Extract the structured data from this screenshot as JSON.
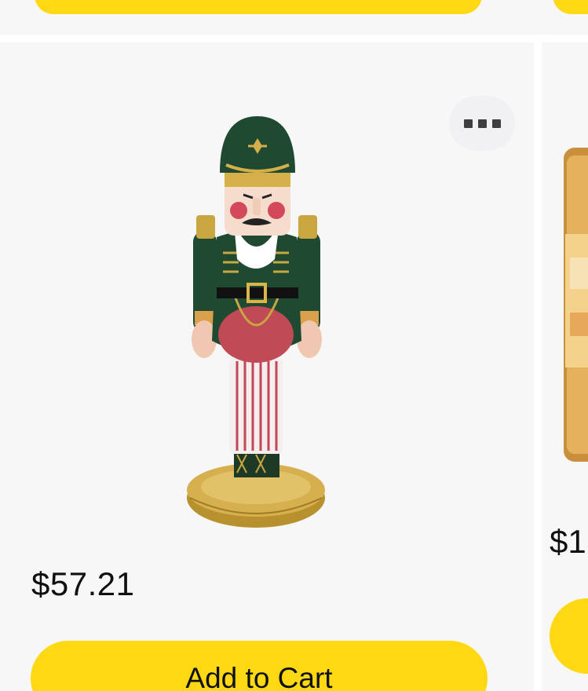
{
  "product": {
    "image_icon": "nutcracker-inflatable",
    "price": "$57.21",
    "add_to_cart_label": "Add to Cart",
    "more_icon": "more-options-icon"
  },
  "neighbor_product": {
    "image_icon": "gold-bottle-product",
    "price_partial": "$1"
  },
  "colors": {
    "button_yellow": "#ffd814",
    "card_background": "#f7f7f8",
    "text": "#0f1111"
  }
}
